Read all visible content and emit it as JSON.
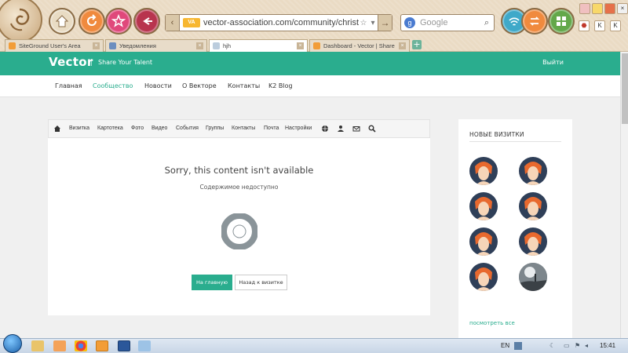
{
  "browser": {
    "url": "vector-association.com/community/christy-white/profile?",
    "site_badge": "VA",
    "search_placeholder": "Google",
    "search_engine_letter": "g",
    "tabs": [
      {
        "label": "SiteGround User's Area"
      },
      {
        "label": "Уведомления"
      },
      {
        "label": "hjh"
      },
      {
        "label": "Dashboard - Vector | Share Yo"
      }
    ],
    "buttons": [
      "home",
      "reload",
      "bookmarks",
      "back",
      "wifi",
      "refresh",
      "grid"
    ],
    "mini_icons": [
      "K",
      "K"
    ]
  },
  "site": {
    "brand": "Vector",
    "tagline": "Share Your Talent",
    "logout": "Выйти",
    "accent": "#2aad8e",
    "nav": [
      {
        "label": "Главная",
        "active": false
      },
      {
        "label": "Сообщество",
        "active": true
      },
      {
        "label": "Новости",
        "active": false
      },
      {
        "label": "О Векторе",
        "active": false
      },
      {
        "label": "Контакты",
        "active": false
      },
      {
        "label": "K2 Blog",
        "active": false
      }
    ]
  },
  "profile_nav": {
    "items": [
      "Визитка",
      "Картотека",
      "Фото",
      "Видео",
      "События",
      "Группы",
      "Контакты",
      "Почта",
      "Настройки"
    ],
    "icons": [
      "home-icon",
      "globe-icon",
      "users-icon",
      "mail-icon",
      "search-icon"
    ]
  },
  "content": {
    "title": "Sorry, this content isn't available",
    "subtitle": "Содержимое недоступно",
    "primary_button": "На главную",
    "secondary_button": "Назад к визитке"
  },
  "sidebar": {
    "title": "НОВЫЕ ВИЗИТКИ",
    "see_all": "посмотреть все",
    "avatars": [
      "avatar",
      "avatar",
      "avatar",
      "avatar",
      "avatar",
      "avatar",
      "avatar",
      "photo-avatar"
    ]
  },
  "taskbar": {
    "lang": "EN",
    "time": "15:41",
    "apps": [
      "explorer",
      "media-player",
      "chrome",
      "browser",
      "word",
      "other"
    ]
  }
}
